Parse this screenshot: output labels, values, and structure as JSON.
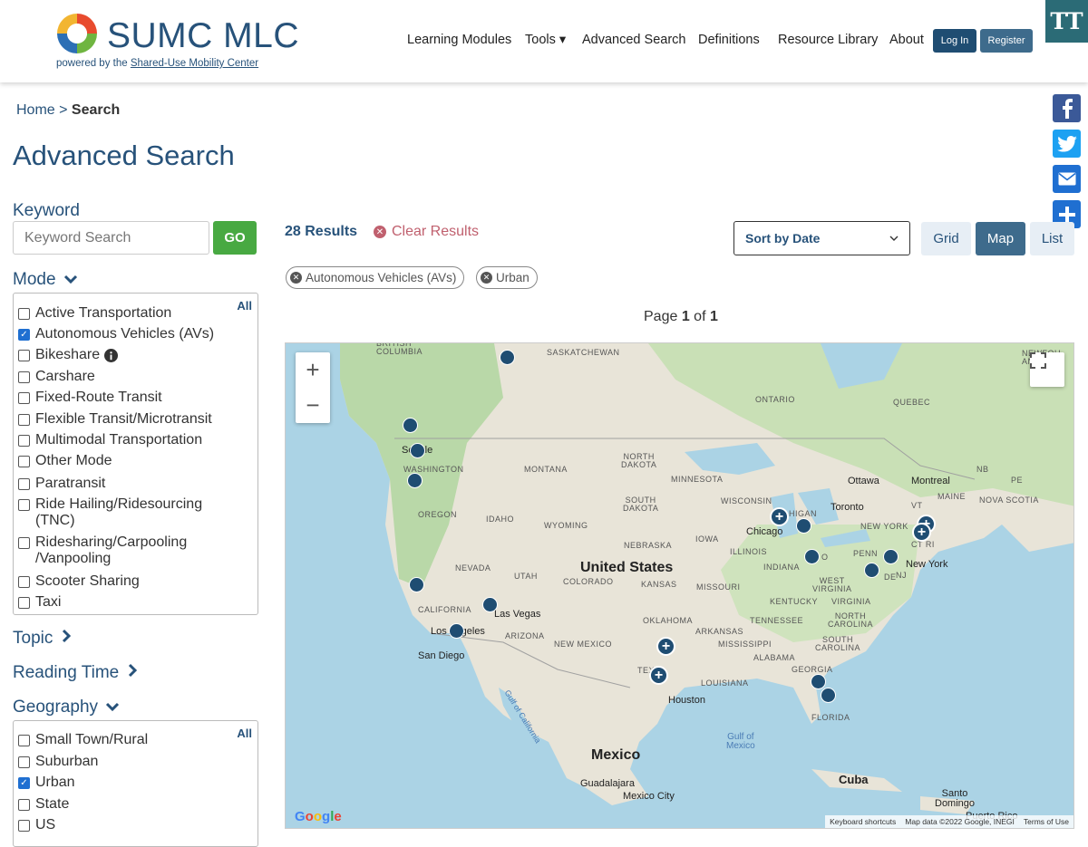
{
  "header": {
    "brand": "SUMC MLC",
    "powered_by": "powered by the ",
    "powered_link": "Shared-Use Mobility Center",
    "nav": [
      "Learning Modules",
      "Tools ▾",
      "Advanced Search",
      "Definitions",
      "Resource Library",
      "About"
    ],
    "login": "Log In",
    "register": "Register",
    "text_size": "TT"
  },
  "breadcrumb": {
    "home": "Home",
    "sep": " > ",
    "current": "Search"
  },
  "page_title": "Advanced Search",
  "keyword": {
    "label": "Keyword",
    "placeholder": "Keyword Search",
    "go": "GO"
  },
  "mode": {
    "label": "Mode",
    "all": "All",
    "items": [
      {
        "label": "Active Transportation",
        "checked": false
      },
      {
        "label": "Autonomous Vehicles (AVs)",
        "checked": true
      },
      {
        "label": "Bikeshare",
        "checked": false
      },
      {
        "label": "Carshare",
        "checked": false
      },
      {
        "label": "Fixed-Route Transit",
        "checked": false
      },
      {
        "label": "Flexible Transit/Microtransit",
        "checked": false
      },
      {
        "label": "Multimodal Transportation",
        "checked": false
      },
      {
        "label": "Other Mode",
        "checked": false
      },
      {
        "label": "Paratransit",
        "checked": false
      },
      {
        "label": "Ride Hailing/Ridesourcing (TNC)",
        "checked": false
      },
      {
        "label": "Ridesharing/Carpooling /Vanpooling",
        "checked": false
      },
      {
        "label": "Scooter Sharing",
        "checked": false
      },
      {
        "label": "Taxi",
        "checked": false
      }
    ]
  },
  "topic": {
    "label": "Topic"
  },
  "reading_time": {
    "label": "Reading Time"
  },
  "geography": {
    "label": "Geography",
    "all": "All",
    "items": [
      {
        "label": "Small Town/Rural",
        "checked": false
      },
      {
        "label": "Suburban",
        "checked": false
      },
      {
        "label": "Urban",
        "checked": true
      },
      {
        "label": "State",
        "checked": false
      },
      {
        "label": "US",
        "checked": false
      }
    ]
  },
  "results": {
    "count": "28 Results",
    "clear": "Clear Results",
    "sort": "Sort by Date",
    "views": [
      "Grid",
      "Map",
      "List"
    ],
    "active_view": "Map",
    "chips": [
      "Autonomous Vehicles (AVs)",
      "Urban"
    ],
    "page_prefix": "Page ",
    "page_current": "1",
    "page_of": " of ",
    "page_total": "1"
  },
  "map": {
    "labels": {
      "british_columbia": "BRITISH\nCOLUMBIA",
      "saskatchewan": "SASKATCHEWAN",
      "ontario": "ONTARIO",
      "quebec": "QUEBEC",
      "newfoundland": "NEWFOU\nAND LA",
      "washington": "WASHINGTON",
      "montana": "MONTANA",
      "north_dakota": "NORTH\nDAKOTA",
      "minnesota": "MINNESOTA",
      "oregon": "OREGON",
      "idaho": "IDAHO",
      "wyoming": "WYOMING",
      "south_dakota": "SOUTH\nDAKOTA",
      "wisconsin": "WISCONSIN",
      "michigan": "HIGAN",
      "nebraska": "NEBRASKA",
      "iowa": "IOWA",
      "illinois": "ILLINOIS",
      "indiana": "INDIANA",
      "nevada": "NEVADA",
      "utah": "UTAH",
      "colorado": "COLORADO",
      "kansas": "KANSAS",
      "missouri": "MISSOURI",
      "california": "CALIFORNIA",
      "arizona": "ARIZONA",
      "new_mexico": "NEW MEXICO",
      "oklahoma": "OKLAHOMA",
      "arkansas": "ARKANSAS",
      "tennessee": "TENNESSEE",
      "kentucky": "KENTUCKY",
      "west_virginia": "WEST\nVIRGINIA",
      "virginia": "VIRGINIA",
      "north_carolina": "NORTH\nCAROLINA",
      "south_carolina": "SOUTH\nCAROLINA",
      "mississippi": "MISSISSIPPI",
      "alabama": "ALABAMA",
      "georgia": "GEORGIA",
      "louisiana": "LOUISIANA",
      "florida": "FLORIDA",
      "penn": "PENN",
      "new_york_state": "NEW YORK",
      "maine": "MAINE",
      "vt": "VT",
      "nb": "NB",
      "pe": "PE",
      "nova_scotia": "NOVA SCOTIA",
      "nj": "NJ",
      "de": "DE",
      "ct_ri": "CT RI",
      "oh": "O",
      "tex": "TEX",
      "united_states": "United States",
      "mexico": "Mexico",
      "cuba": "Cuba",
      "ottawa": "Ottawa",
      "montreal": "Montreal",
      "toronto": "Toronto",
      "chicago": "Chicago",
      "new_york": "New York",
      "seattle": "Seattle",
      "las_vegas": "Las Vegas",
      "los_angeles": "Los Angeles",
      "san_diego": "San Diego",
      "houston": "Houston",
      "guadalajara": "Guadalajara",
      "mexico_city": "Mexico City",
      "santo_domingo": "Santo\nDomingo",
      "puerto_rico": "Puerto Rico",
      "gulf_of_mexico": "Gulf of\nMexico",
      "gulf_of_california": "Gulf of California"
    },
    "zoom_in": "+",
    "zoom_out": "−",
    "google": "Google",
    "attribution": [
      "Keyboard shortcuts",
      "Map data ©2022 Google, INEGI",
      "Terms of Use"
    ]
  },
  "colors": {
    "brand": "#27527a",
    "go_green": "#48a942",
    "clear_red": "#c0606e",
    "pin": "#1f4d72",
    "facebook": "#3b5998",
    "twitter": "#1da1f2",
    "email": "#1f6fd1",
    "share": "#1f6fd1"
  },
  "share": {
    "icons": [
      "facebook-icon",
      "twitter-icon",
      "email-icon",
      "share-plus-icon"
    ]
  }
}
